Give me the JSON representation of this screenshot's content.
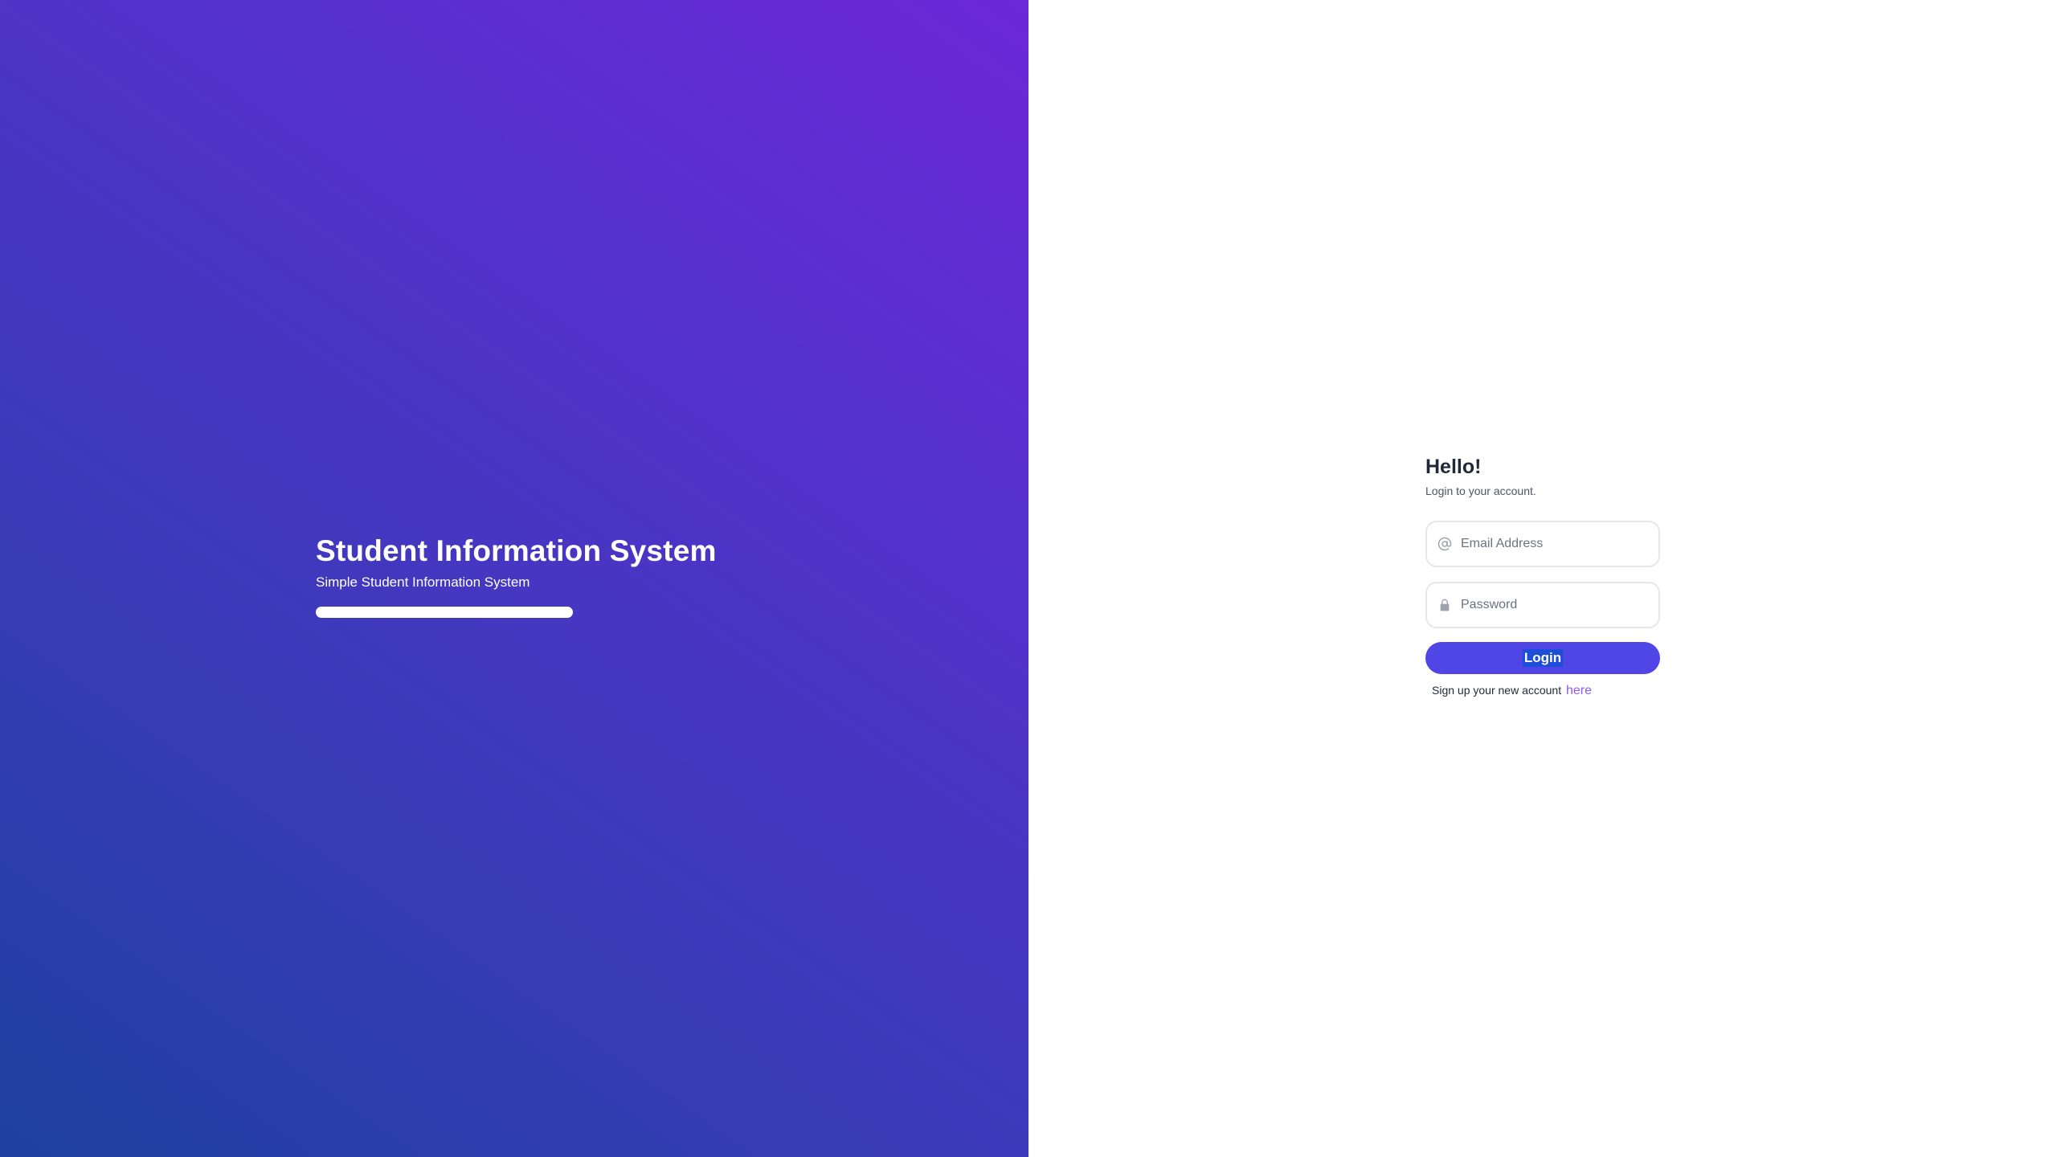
{
  "branding": {
    "title": "Student Information System",
    "subtitle": "Simple Student Information System"
  },
  "login": {
    "greeting": "Hello!",
    "subtitle": "Login to your account.",
    "email": {
      "placeholder": "Email Address",
      "value": "",
      "icon": "at-icon"
    },
    "password": {
      "placeholder": "Password",
      "value": "",
      "icon": "lock-icon"
    },
    "login_label": "Login",
    "signup_text": "Sign up your new account",
    "signup_link": "here"
  },
  "colors": {
    "gradient_start": "#1e40a0",
    "gradient_end": "#6d28d9",
    "button": "#4f46e5",
    "link": "#8b5cf6"
  }
}
